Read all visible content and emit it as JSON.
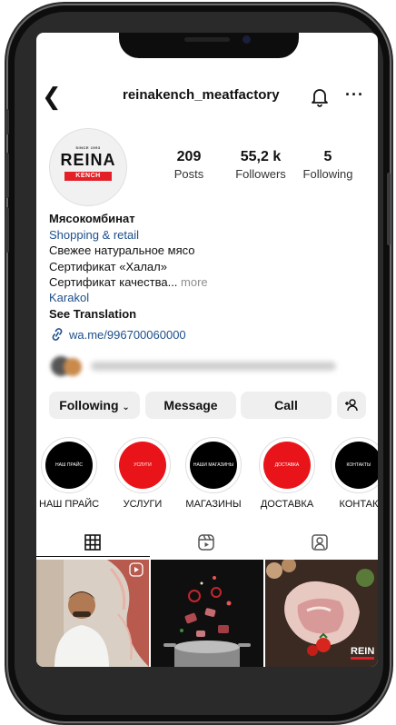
{
  "profile": {
    "username": "reinakench_meatfactory",
    "logo": {
      "since": "SINCE 1993",
      "brand": "REINA",
      "sub": "KENCH"
    },
    "stats": [
      {
        "value": "209",
        "label": "Posts"
      },
      {
        "value": "55,2 k",
        "label": "Followers"
      },
      {
        "value": "5",
        "label": "Following"
      }
    ],
    "name": "Мясокомбинат",
    "category": "Shopping & retail",
    "bio": [
      "Свежее натуральное мясо",
      "Сертификат «Халал»",
      "Сертификат качества..."
    ],
    "more": "more",
    "location": "Karakol",
    "see_translation": "See Translation",
    "website": "wa.me/996700060000"
  },
  "buttons": {
    "following": "Following",
    "message": "Message",
    "call": "Call"
  },
  "highlights": [
    {
      "inner": "НАШ ПРАЙС",
      "label": "НАШ ПРАЙС",
      "color": "#000000"
    },
    {
      "inner": "УСЛУГИ",
      "label": "УСЛУГИ",
      "color": "#e8141a"
    },
    {
      "inner": "НАШИ МАГАЗИНЫ",
      "label": "МАГАЗИНЫ",
      "color": "#000000"
    },
    {
      "inner": "ДОСТАВКА",
      "label": "ДОСТАВКА",
      "color": "#e8141a"
    },
    {
      "inner": "КОНТАКТЫ",
      "label": "КОНТАК",
      "color": "#000000"
    }
  ],
  "tabs": [
    {
      "name": "grid-icon",
      "active": true
    },
    {
      "name": "reels-icon",
      "active": false
    },
    {
      "name": "tagged-icon",
      "active": false
    }
  ],
  "posts": [
    {
      "thumb": "man-with-meat-photo"
    },
    {
      "thumb": "meat-falling-into-pot-photo"
    },
    {
      "thumb": "fresh-meat-cut-photo",
      "watermark": "REINA"
    }
  ]
}
